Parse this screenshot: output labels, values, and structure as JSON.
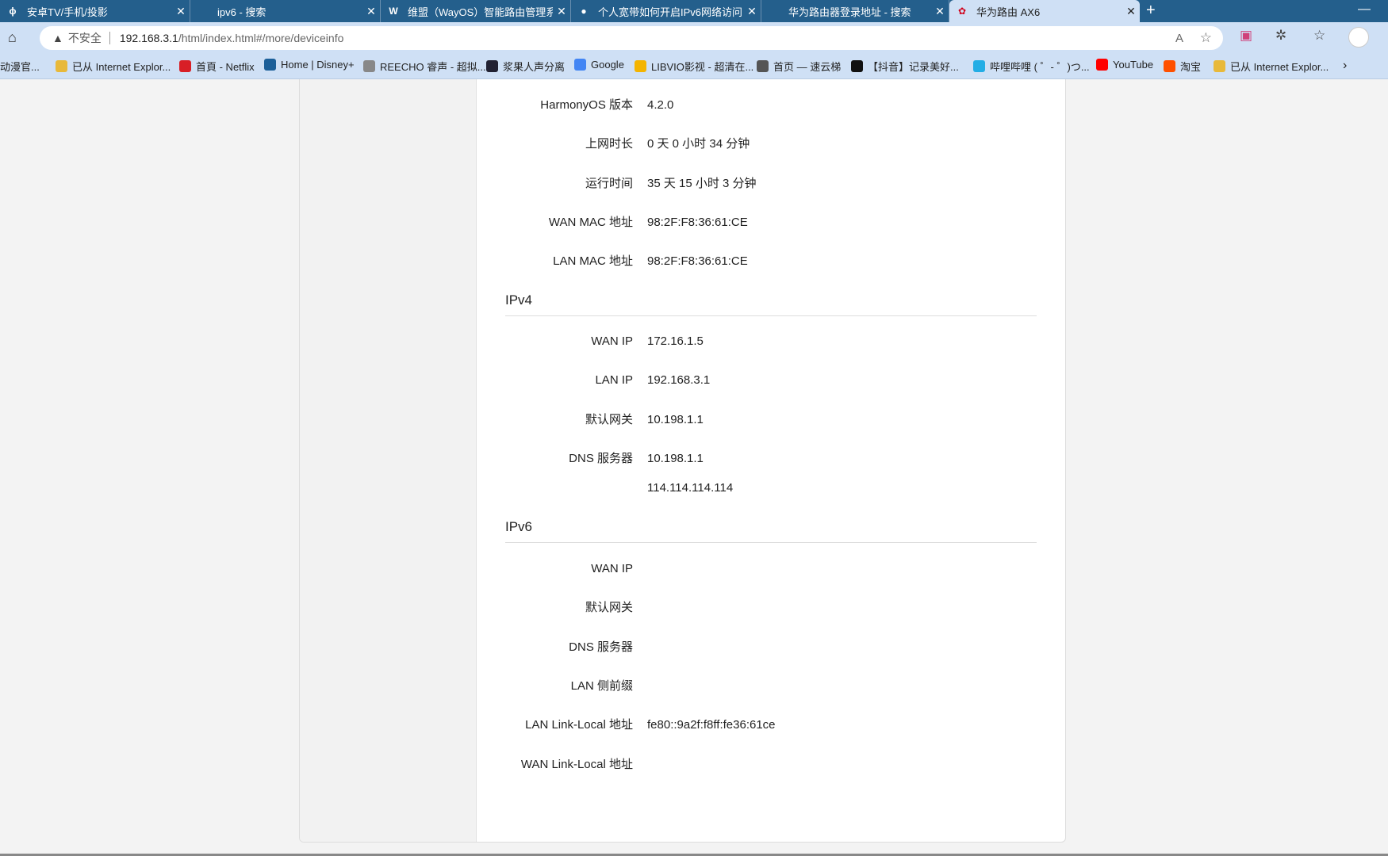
{
  "browser": {
    "tabs": [
      {
        "title": "安卓TV/手机/投影",
        "icon": "ϕ"
      },
      {
        "title": "ipv6 - 搜索",
        "icon": ""
      },
      {
        "title": "维盟（WayOS）智能路由管理系统",
        "icon": "W"
      },
      {
        "title": "个人宽带如何开启IPv6网络访问 |",
        "icon": "●"
      },
      {
        "title": "华为路由器登录地址 - 搜索",
        "icon": ""
      },
      {
        "title": "华为路由 AX6",
        "icon": "✿"
      }
    ],
    "new_tab": "+",
    "minimize": "—",
    "address": {
      "security": "不安全",
      "host": "192.168.3.1",
      "path": "/html/index.html#/more/deviceinfo"
    },
    "bookmarks": [
      {
        "label": "动漫官...",
        "color": "transparent"
      },
      {
        "label": "已从 Internet Explor...",
        "color": "#e8b93a"
      },
      {
        "label": "首頁 - Netflix",
        "color": "#d81f26"
      },
      {
        "label": "Home | Disney+",
        "color": "#1b5f99"
      },
      {
        "label": "REECHO 睿声 - 超拟...",
        "color": "#888"
      },
      {
        "label": "浆果人声分离",
        "color": "#223"
      },
      {
        "label": "Google",
        "color": "#4285f4"
      },
      {
        "label": "LIBVIO影视 - 超清在...",
        "color": "#f4b400"
      },
      {
        "label": "首页 — 速云梯",
        "color": "#555"
      },
      {
        "label": "【抖音】记录美好...",
        "color": "#111"
      },
      {
        "label": "哔哩哔哩 ( ゜- ゜)つ...",
        "color": "#23ade5"
      },
      {
        "label": "YouTube",
        "color": "#ff0000"
      },
      {
        "label": "淘宝",
        "color": "#ff5000"
      },
      {
        "label": "已从 Internet Explor...",
        "color": "#e8b93a"
      }
    ]
  },
  "device": {
    "general": [
      {
        "label": "HarmonyOS 版本",
        "value": "4.2.0"
      },
      {
        "label": "上网时长",
        "value": "0 天 0 小时 34 分钟"
      },
      {
        "label": "运行时间",
        "value": "35 天 15 小时 3 分钟"
      },
      {
        "label": "WAN MAC 地址",
        "value": "98:2F:F8:36:61:CE"
      },
      {
        "label": "LAN MAC 地址",
        "value": "98:2F:F8:36:61:CE"
      }
    ],
    "ipv4": {
      "title": "IPv4",
      "rows": [
        {
          "label": "WAN IP",
          "value": "172.16.1.5"
        },
        {
          "label": "LAN IP",
          "value": "192.168.3.1"
        },
        {
          "label": "默认网关",
          "value": "10.198.1.1"
        },
        {
          "label": "DNS 服务器",
          "value": "10.198.1.1"
        },
        {
          "label": "",
          "value": "114.114.114.114"
        }
      ]
    },
    "ipv6": {
      "title": "IPv6",
      "rows": [
        {
          "label": "WAN IP",
          "value": ""
        },
        {
          "label": "默认网关",
          "value": ""
        },
        {
          "label": "DNS 服务器",
          "value": ""
        },
        {
          "label": "LAN 侧前缀",
          "value": ""
        },
        {
          "label": "LAN Link-Local 地址",
          "value": "fe80::9a2f:f8ff:fe36:61ce"
        },
        {
          "label": "WAN Link-Local 地址",
          "value": ""
        }
      ]
    }
  }
}
